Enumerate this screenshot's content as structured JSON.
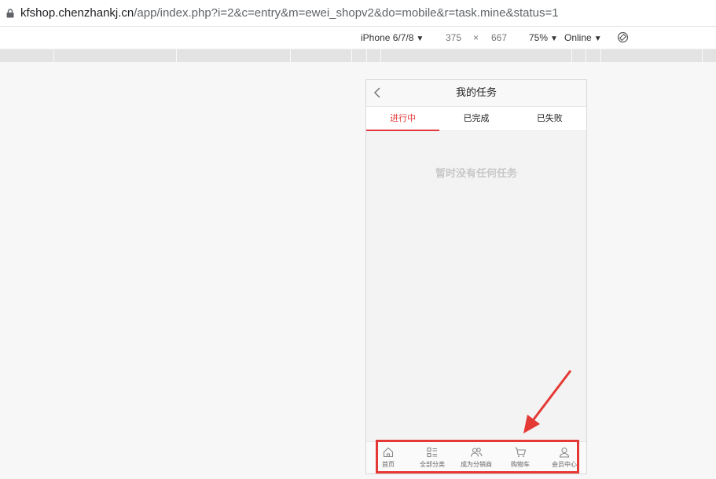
{
  "browser": {
    "url_host": "kfshop.chenzhankj.cn",
    "url_path": "/app/index.php?i=2&c=entry&m=ewei_shopv2&do=mobile&r=task.mine&status=1"
  },
  "devtools": {
    "device": "iPhone 6/7/8",
    "width": "375",
    "times": "×",
    "height": "667",
    "zoom": "75%",
    "network": "Online"
  },
  "page": {
    "title": "我的任务",
    "tabs": [
      "进行中",
      "已完成",
      "已失败"
    ],
    "active_tab": 0,
    "empty_message": "暂时没有任何任务"
  },
  "tabbar": {
    "items": [
      {
        "label": "首页",
        "icon": "home-icon"
      },
      {
        "label": "全部分类",
        "icon": "category-icon"
      },
      {
        "label": "成为分销商",
        "icon": "distributor-icon"
      },
      {
        "label": "购物车",
        "icon": "cart-icon"
      },
      {
        "label": "会员中心",
        "icon": "user-icon"
      }
    ]
  },
  "colors": {
    "accent": "#e4393c",
    "annotation": "#e53935"
  }
}
